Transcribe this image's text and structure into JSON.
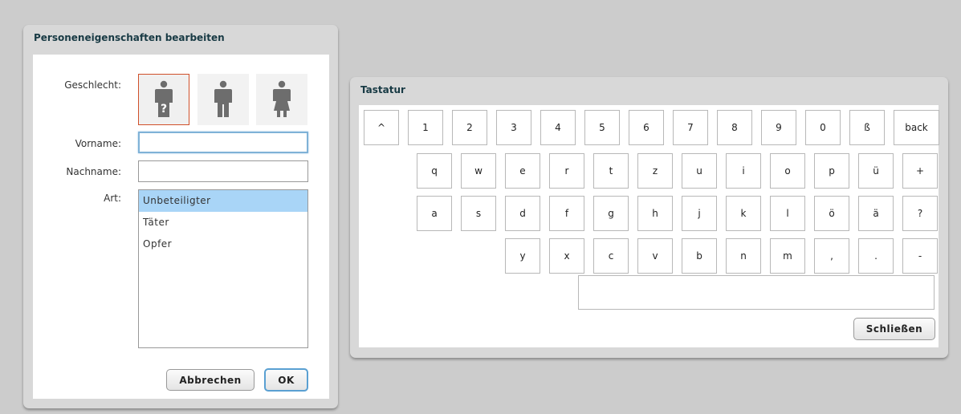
{
  "dialog": {
    "title": "Personeneigenschaften bearbeiten",
    "gender_label": "Geschlecht:",
    "gender_options": [
      {
        "name": "unknown-person-icon",
        "selected": true
      },
      {
        "name": "male-person-icon",
        "selected": false
      },
      {
        "name": "female-person-icon",
        "selected": false
      }
    ],
    "firstname_label": "Vorname:",
    "firstname_value": "",
    "lastname_label": "Nachname:",
    "lastname_value": "",
    "type_label": "Art:",
    "type_options": [
      "Unbeteiligter",
      "Täter",
      "Opfer"
    ],
    "type_selected": "Unbeteiligter",
    "cancel_label": "Abbrechen",
    "ok_label": "OK"
  },
  "keyboard": {
    "title": "Tastatur",
    "rows": [
      [
        "^",
        "1",
        "2",
        "3",
        "4",
        "5",
        "6",
        "7",
        "8",
        "9",
        "0",
        "ß",
        "back"
      ],
      [
        "q",
        "w",
        "e",
        "r",
        "t",
        "z",
        "u",
        "i",
        "o",
        "p",
        "ü",
        "+"
      ],
      [
        "a",
        "s",
        "d",
        "f",
        "g",
        "h",
        "j",
        "k",
        "l",
        "ö",
        "ä",
        "?"
      ],
      [
        "y",
        "x",
        "c",
        "v",
        "b",
        "n",
        "m",
        ",",
        ".",
        "-"
      ]
    ],
    "text_value": "",
    "close_label": "Schließen"
  },
  "colors": {
    "selection": "#a9d5f7",
    "focus_border": "#7fb2d7",
    "gender_selected_border": "#d0502a",
    "title_text": "#183a44"
  }
}
